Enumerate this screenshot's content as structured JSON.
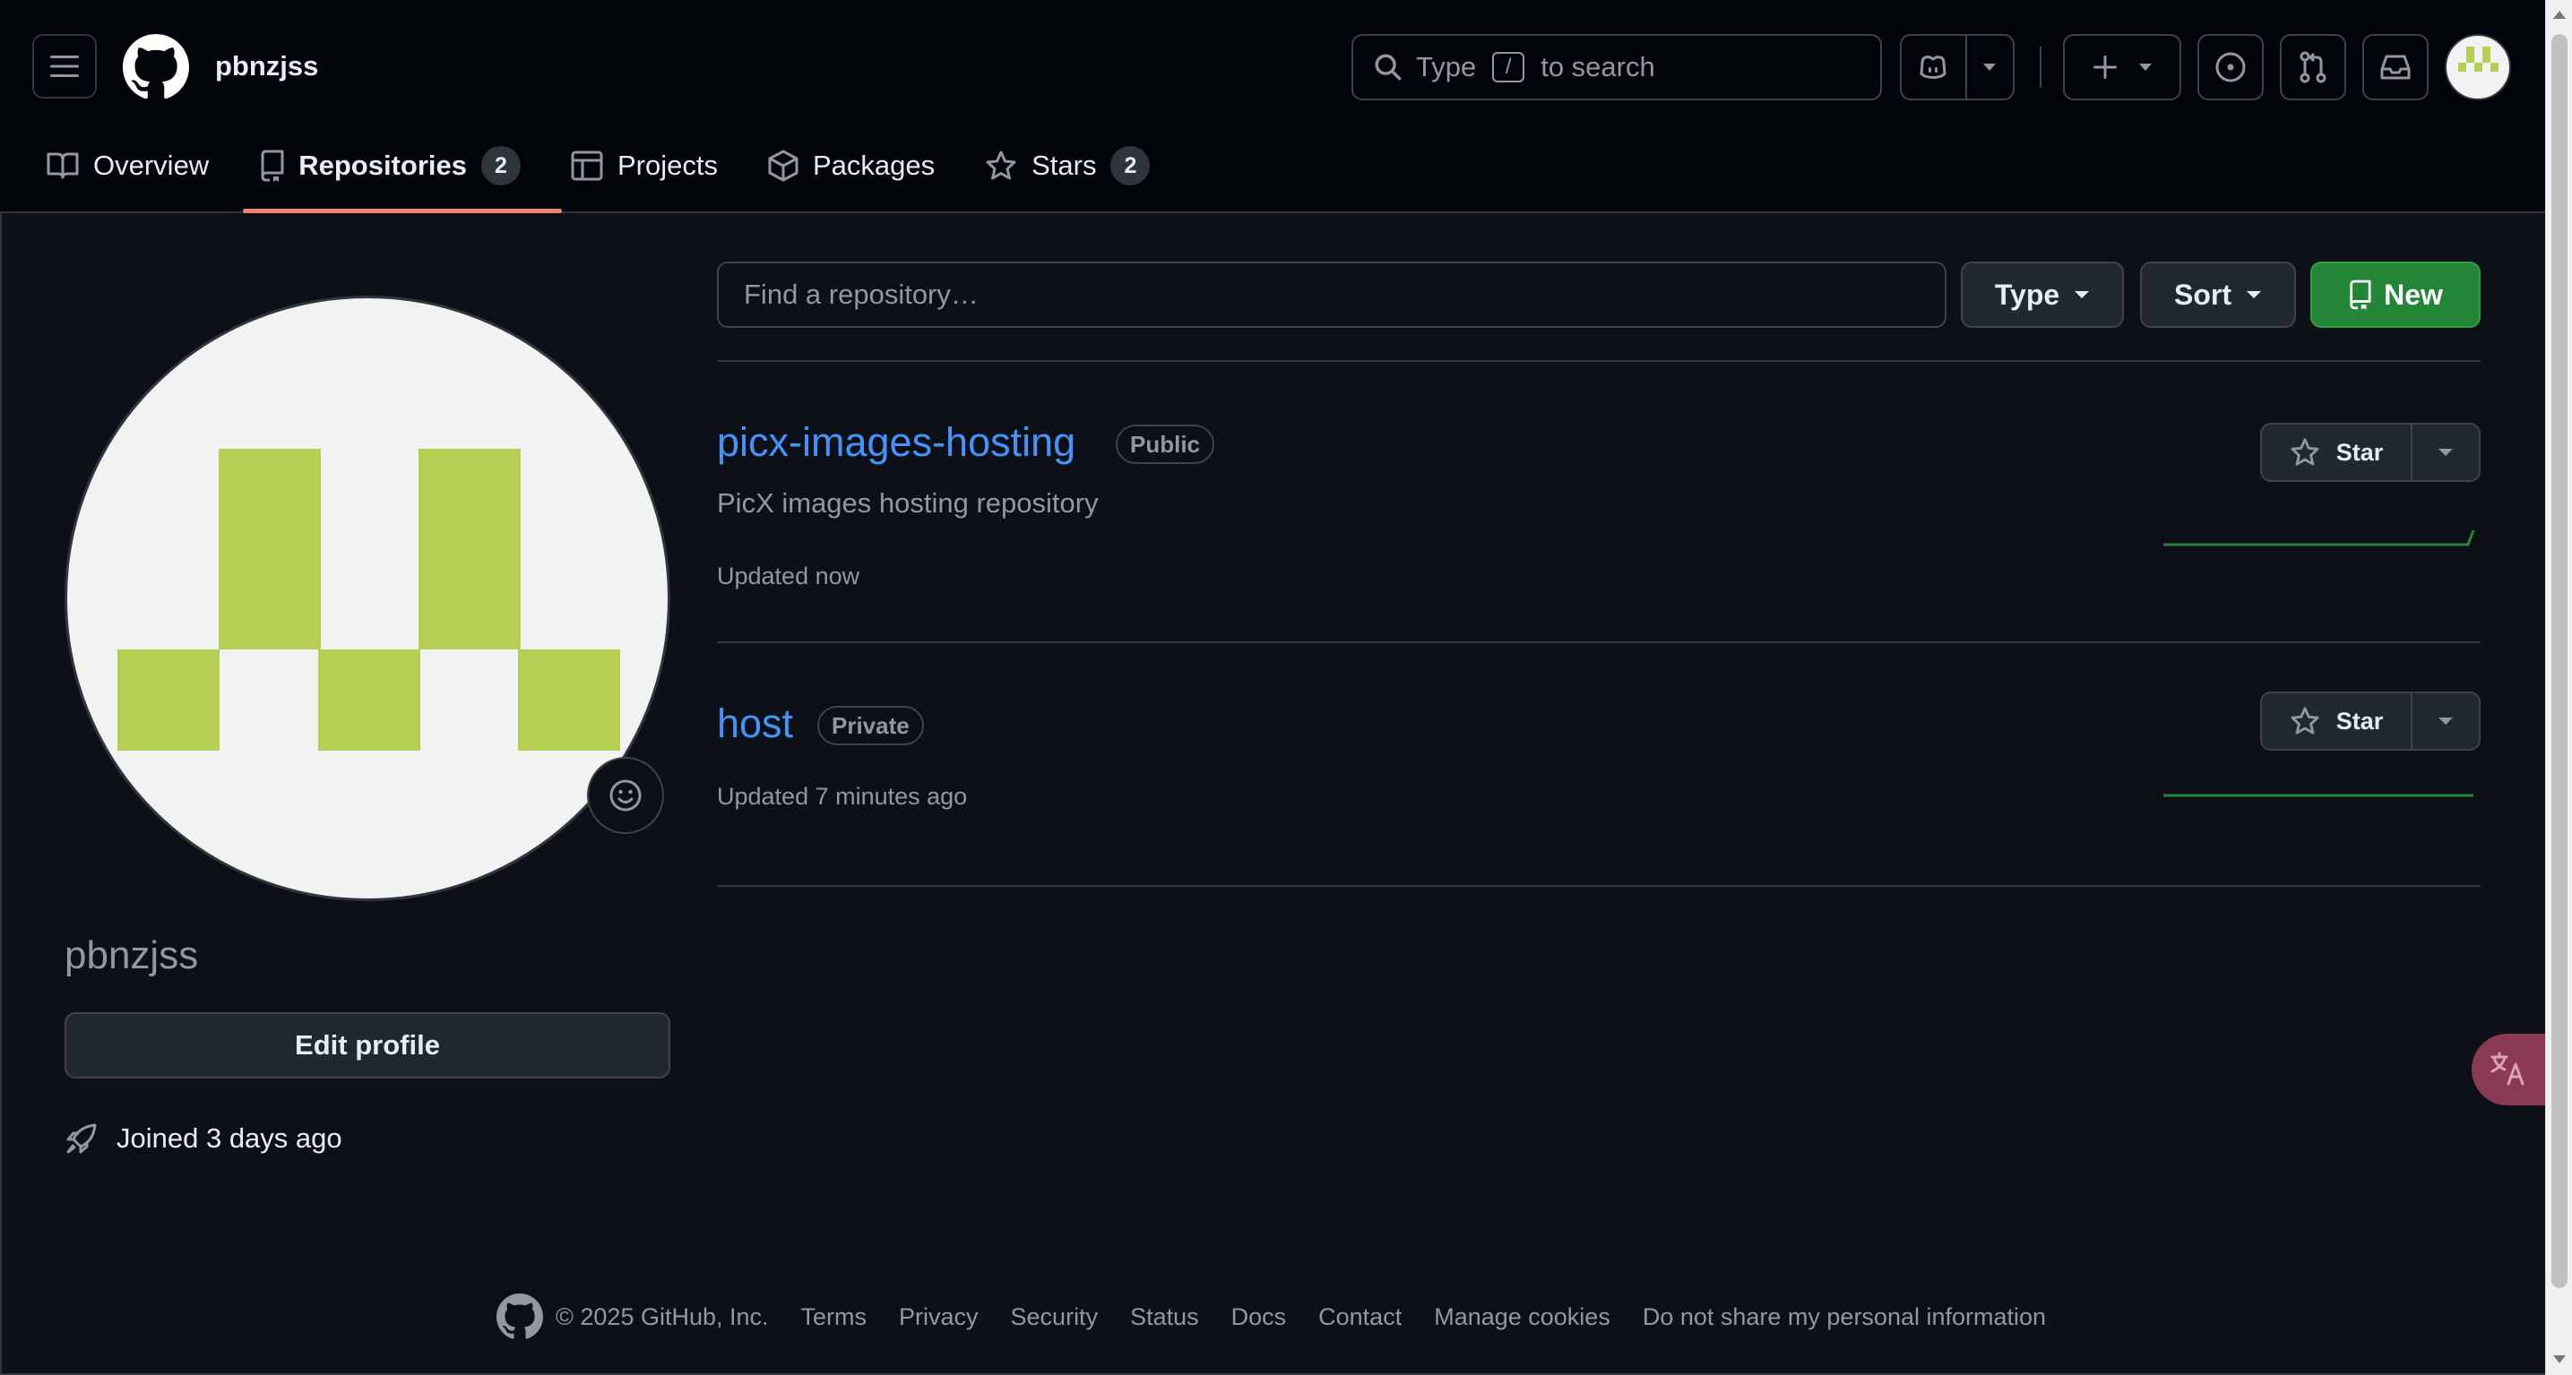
{
  "header": {
    "username": "pbnzjss",
    "search": {
      "prefix": "Type",
      "key": "/",
      "suffix": "to search"
    }
  },
  "tabs": [
    {
      "label": "Overview",
      "icon": "book-icon"
    },
    {
      "label": "Repositories",
      "icon": "repo-icon",
      "count": "2",
      "active": true
    },
    {
      "label": "Projects",
      "icon": "table-icon"
    },
    {
      "label": "Packages",
      "icon": "package-icon"
    },
    {
      "label": "Stars",
      "icon": "star-icon",
      "count": "2"
    }
  ],
  "profile": {
    "name": "pbnzjss",
    "edit_label": "Edit profile",
    "joined": "Joined 3 days ago"
  },
  "toolbar": {
    "find_placeholder": "Find a repository…",
    "type_label": "Type",
    "sort_label": "Sort",
    "new_label": "New"
  },
  "repos": [
    {
      "name": "picx-images-hosting",
      "visibility": "Public",
      "description": "PicX images hosting repository",
      "updated": "Updated now",
      "star_label": "Star"
    },
    {
      "name": "host",
      "visibility": "Private",
      "description": "",
      "updated": "Updated 7 minutes ago",
      "star_label": "Star"
    }
  ],
  "footer": {
    "copyright": "© 2025 GitHub, Inc.",
    "links": [
      "Terms",
      "Privacy",
      "Security",
      "Status",
      "Docs",
      "Contact",
      "Manage cookies",
      "Do not share my personal information"
    ]
  },
  "colors": {
    "accent_tab": "#f78166",
    "link": "#4493f8",
    "new_button": "#238636",
    "avatar_green": "#b4cf52"
  }
}
